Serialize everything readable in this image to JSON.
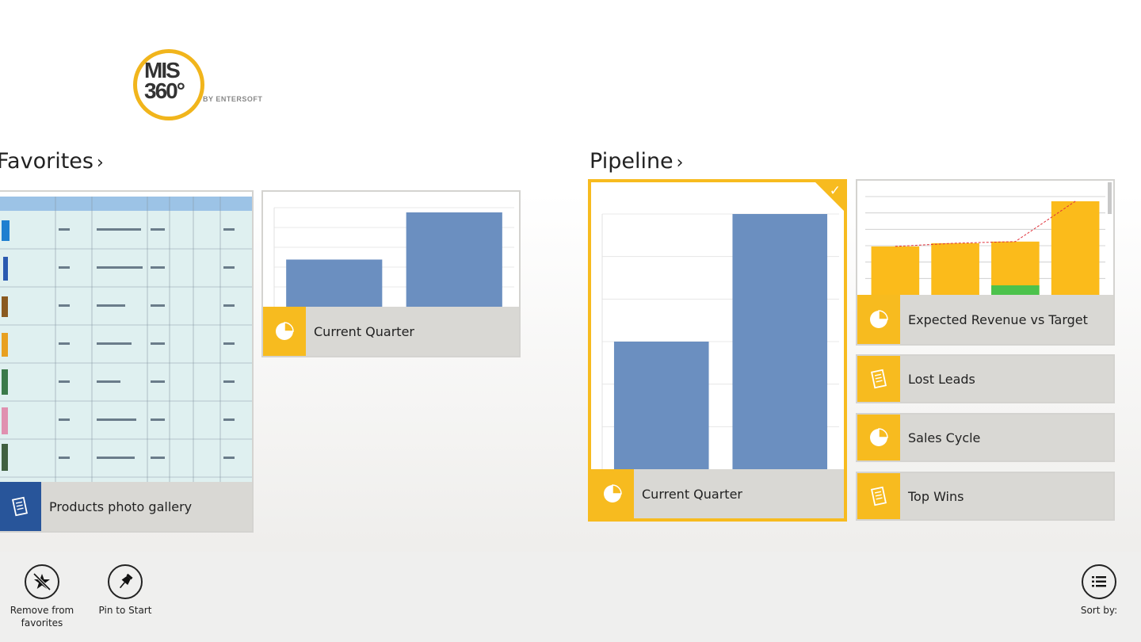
{
  "logo": {
    "line1": "MIS",
    "line2": "360°",
    "by": "BY ENTERSOFT"
  },
  "groups": {
    "favorites": {
      "title": "Favorites"
    },
    "pipeline": {
      "title": "Pipeline"
    }
  },
  "tiles": {
    "products_gallery": "Products photo gallery",
    "fav_current_quarter": "Current Quarter",
    "pipe_current_quarter": "Current Quarter",
    "expected_revenue": "Expected Revenue vs Target",
    "lost_leads": "Lost Leads",
    "sales_cycle": "Sales Cycle",
    "top_wins": "Top Wins"
  },
  "chart_data": [
    {
      "type": "bar",
      "values": [
        1,
        2
      ]
    },
    {
      "type": "bar",
      "values": [
        1,
        2
      ]
    },
    {
      "type": "bar",
      "values": [
        3,
        3.2,
        3.3,
        5.8
      ]
    }
  ],
  "appbar": {
    "remove_line1": "Remove from",
    "remove_line2": "favorites",
    "pin": "Pin to Start",
    "sort": "Sort by:"
  },
  "colors": {
    "accent": "#f7bb1f",
    "bar_blue": "#6b8fc0",
    "brand_blue": "#28559a"
  }
}
